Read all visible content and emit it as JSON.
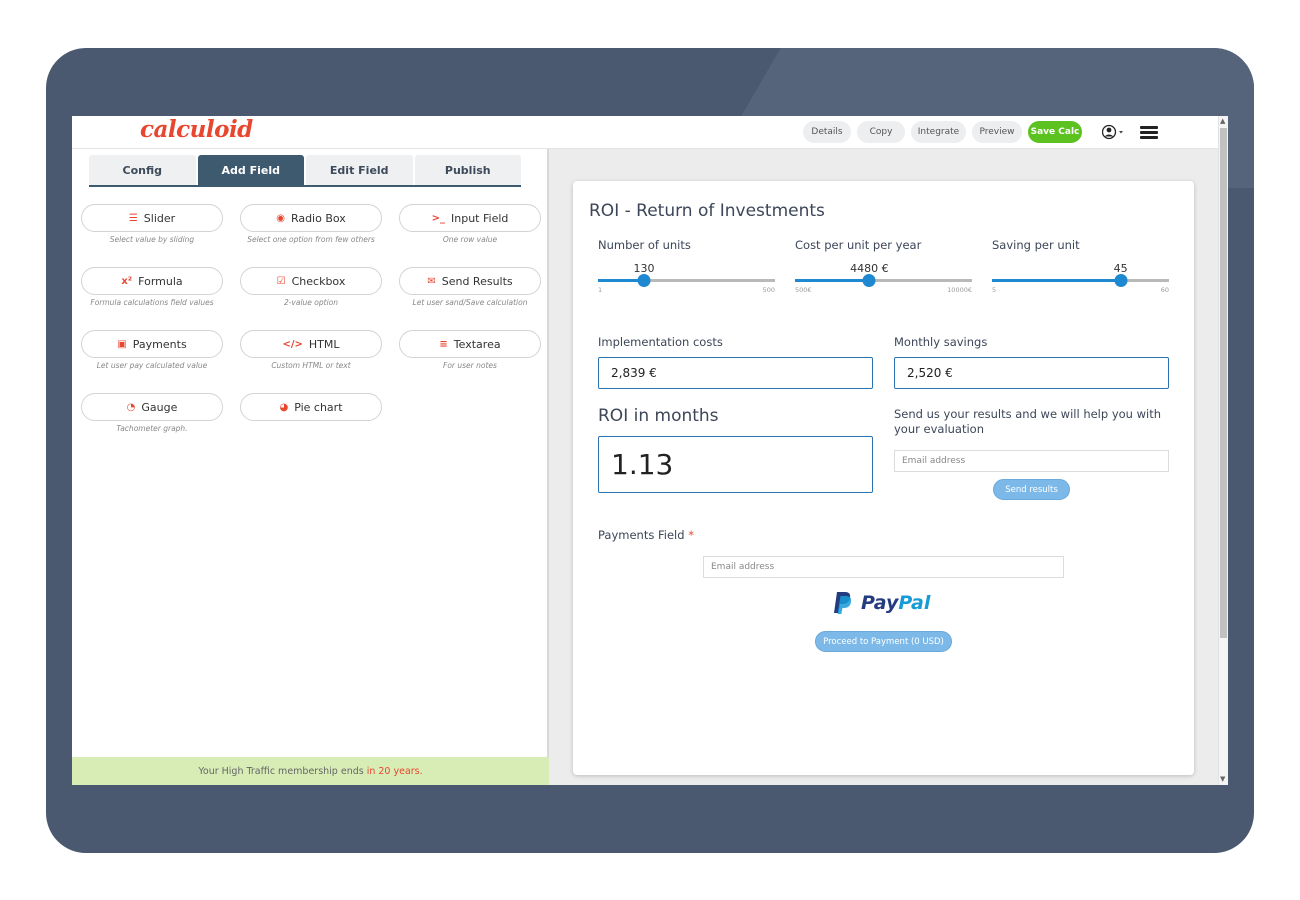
{
  "topbar": {
    "logo": "calculoid",
    "buttons": [
      "Details",
      "Copy",
      "Integrate",
      "Preview"
    ],
    "save_label": "Save Calc"
  },
  "left": {
    "tabs": [
      "Config",
      "Add Field",
      "Edit Field",
      "Publish"
    ],
    "active_tab": "Add Field",
    "fields": [
      {
        "label": "Slider",
        "desc": "Select value by sliding",
        "icon": "sliders-icon"
      },
      {
        "label": "Radio Box",
        "desc": "Select one option from few others",
        "icon": "radio-icon"
      },
      {
        "label": "Input Field",
        "desc": "One row value",
        "icon": "terminal-icon"
      },
      {
        "label": "Formula",
        "desc": "Formula calculations field values",
        "icon": "superscript-icon"
      },
      {
        "label": "Checkbox",
        "desc": "2-value option",
        "icon": "checkbox-icon"
      },
      {
        "label": "Send Results",
        "desc": "Let user sand/Save calculation",
        "icon": "envelope-icon"
      },
      {
        "label": "Payments",
        "desc": "Let user pay calculated value",
        "icon": "money-icon"
      },
      {
        "label": "HTML",
        "desc": "Custom HTML or text",
        "icon": "code-icon"
      },
      {
        "label": "Textarea",
        "desc": "For user notes",
        "icon": "align-left-icon"
      },
      {
        "label": "Gauge",
        "desc": "Tachometer graph.",
        "icon": "gauge-icon"
      },
      {
        "label": "Pie chart",
        "desc": "",
        "icon": "pie-chart-icon"
      }
    ],
    "membership": {
      "text": "Your High Traffic membership ends",
      "highlight": "in 20 years."
    }
  },
  "calc": {
    "title": "ROI - Return of Investments",
    "sliders": [
      {
        "label": "Number of units",
        "value": "130",
        "min": "1",
        "max": "500",
        "fraction": 0.26
      },
      {
        "label": "Cost per unit per year",
        "value": "4480 €",
        "min": "500€",
        "max": "10000€",
        "fraction": 0.42
      },
      {
        "label": "Saving per unit",
        "value": "45",
        "min": "5",
        "max": "60",
        "fraction": 0.727
      }
    ],
    "implementation_label": "Implementation costs",
    "implementation_value": "2,839 €",
    "monthly_label": "Monthly savings",
    "monthly_value": "2,520 €",
    "roi_label": "ROI in months",
    "roi_value": "1.13",
    "send_text": "Send us your results and we will help you with your evaluation",
    "email_placeholder": "Email address",
    "send_button": "Send results",
    "payments_label": "Payments Field",
    "payments_required": "*",
    "payment_email_placeholder": "Email address",
    "paypal_left": "Pay",
    "paypal_right": "Pal",
    "proceed_button": "Proceed to Payment (0 USD)"
  },
  "colors": {
    "accent": "#e8462f",
    "tab_active": "#3e5a6e",
    "save": "#5cc21f",
    "slider": "#1e88d0"
  }
}
